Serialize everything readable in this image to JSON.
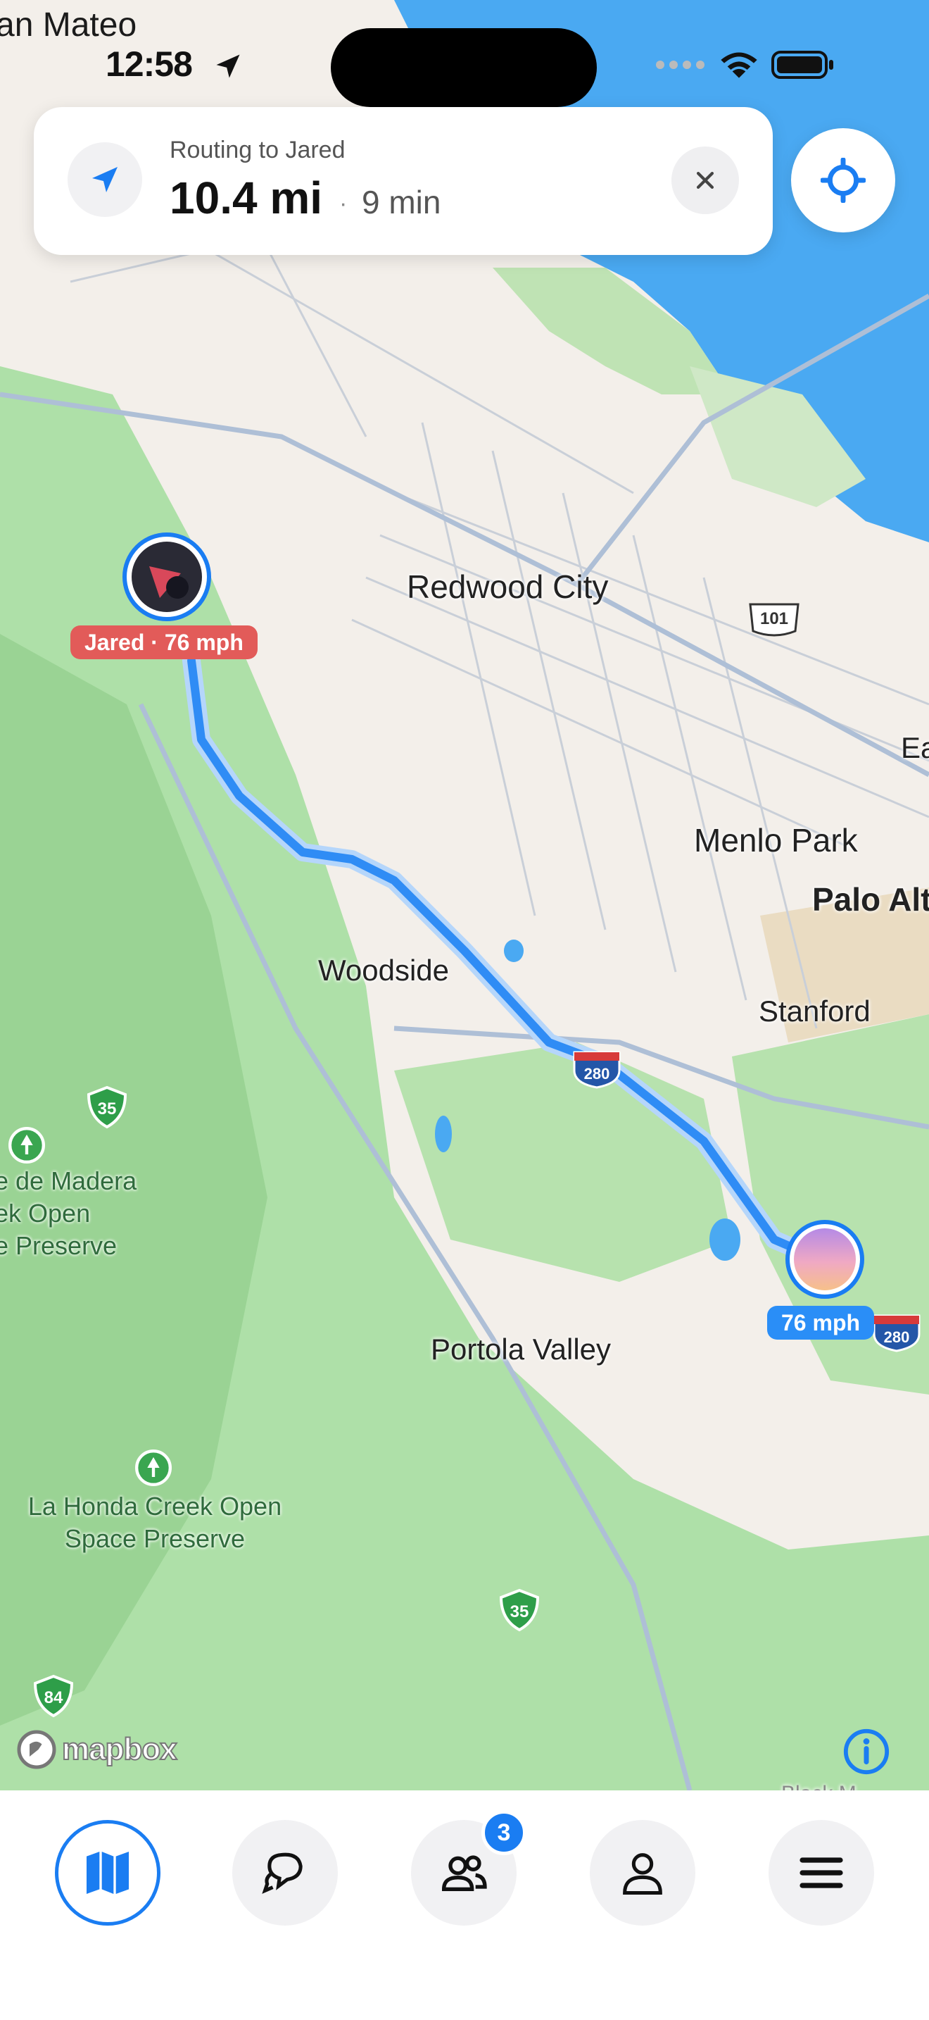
{
  "status_bar": {
    "time": "12:58",
    "partial_city": "an Mateo"
  },
  "route_card": {
    "label": "Routing to Jared",
    "distance": "10.4 mi",
    "separator": "·",
    "duration": "9 min"
  },
  "map": {
    "places": {
      "redwood_city": "Redwood City",
      "menlo_park": "Menlo Park",
      "palo_alto": "Palo Alt",
      "east": "Ea",
      "woodside": "Woodside",
      "stanford": "Stanford",
      "portola_valley": "Portola Valley"
    },
    "parks": {
      "madera": [
        "e de Madera",
        "ek Open",
        "e Preserve"
      ],
      "la_honda": [
        "La Honda Creek Open",
        "Space Preserve"
      ]
    },
    "shields": {
      "hwy101": "101",
      "i280_mid": "280",
      "i280_right": "280",
      "hwy35_top": "35",
      "hwy35_bottom": "35",
      "hwy84": "84"
    },
    "jared_pill": "Jared · 76 mph",
    "me_pill": "76 mph",
    "attribution": "mapbox",
    "bottom_partial": "Black M"
  },
  "tabbar": {
    "friends_badge": "3"
  },
  "colors": {
    "accent": "#1a7df2",
    "route": "#2f8cf5",
    "water": "#4aa9f2",
    "park": "#aee0a8"
  }
}
